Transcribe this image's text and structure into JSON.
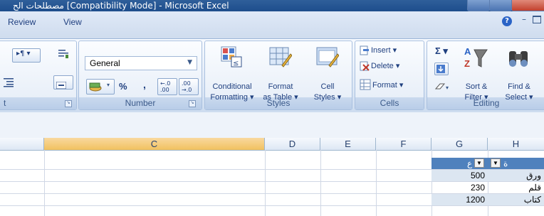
{
  "window": {
    "title": "مصطلحات الح [Compatibility Mode] - Microsoft Excel"
  },
  "tabs": [
    {
      "label": "Review"
    },
    {
      "label": "View"
    }
  ],
  "ribbon": {
    "number_group": {
      "label": "Number",
      "format_value": "General",
      "percent": "%",
      "comma": ",",
      "inc_decimal": "←.0\n.00",
      "dec_decimal": ".00\n→.0"
    },
    "styles_group": {
      "label": "Styles",
      "conditional_formatting": [
        "Conditional",
        "Formatting ▾"
      ],
      "format_as_table": [
        "Format",
        "as Table ▾"
      ],
      "cell_styles": [
        "Cell",
        "Styles ▾"
      ]
    },
    "cells_group": {
      "label": "Cells",
      "insert": "Insert ▾",
      "delete": "Delete ▾",
      "format": "Format ▾"
    },
    "editing_group": {
      "label": "Editing",
      "sigma": "Σ ▾",
      "sort_filter": [
        "Sort &",
        "Filter ▾"
      ],
      "find_select": [
        "Find &",
        "Select ▾"
      ]
    },
    "left_group_label": "t"
  },
  "sheet": {
    "columns": [
      "C",
      "D",
      "E",
      "F",
      "G",
      "H"
    ],
    "selected_column": "C",
    "header_row": {
      "G": "ع",
      "H": "ة"
    },
    "rows": [
      {
        "G": "500",
        "H": "ورق"
      },
      {
        "G": "230",
        "H": "قلم"
      },
      {
        "G": "1200",
        "H": "كتاب"
      }
    ]
  },
  "colors": {
    "title_bar": "#1d4d8c",
    "selected_header": "#f1c15f",
    "table_header": "#4f81bd"
  }
}
